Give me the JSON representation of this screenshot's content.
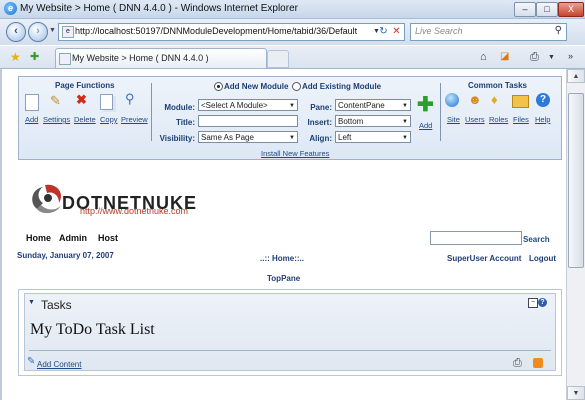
{
  "window": {
    "title": "My Website > Home ( DNN 4.4.0 ) - Windows Internet Explorer",
    "controls": [
      "–",
      "□",
      "X"
    ]
  },
  "browser": {
    "back_icon": "back-arrow-icon",
    "forward_icon": "forward-arrow-icon",
    "address": "http://localhost:50197/DNNModuleDevelopment/Home/tabid/36/Default",
    "refresh_glyph": "↻",
    "stop_glyph": "✕",
    "search_placeholder": "Live Search",
    "tab_title": "My Website > Home ( DNN 4.4.0 )",
    "toolbar_glyphs": {
      "home": "⌂",
      "feeds": "◪",
      "print": "⎙",
      "favorites": "★",
      "add_favorites": "✚"
    }
  },
  "control_panel": {
    "page_functions_header": "Page Functions",
    "page_functions": [
      "Add",
      "Settings",
      "Delete",
      "Copy",
      "Preview"
    ],
    "add_new_module": "Add New Module",
    "add_existing_module": "Add Existing Module",
    "module_label": "Module:",
    "module_value": "<Select A Module>",
    "pane_label": "Pane:",
    "pane_value": "ContentPane",
    "title_label": "Title:",
    "title_value": "",
    "insert_label": "Insert:",
    "insert_value": "Bottom",
    "visibility_label": "Visibility:",
    "visibility_value": "Same As Page",
    "align_label": "Align:",
    "align_value": "Left",
    "add_label": "Add",
    "install_features": "Install New Features",
    "common_tasks_header": "Common Tasks",
    "common_tasks": [
      "Site",
      "Users",
      "Roles",
      "Files",
      "Help"
    ]
  },
  "site": {
    "logo_text": "DOTNETNUKE",
    "logo_url": "http://www.dotnetnuke.com",
    "menu": [
      "Home",
      "Admin",
      "Host"
    ],
    "search_label": "Search",
    "date": "Sunday, January 07, 2007",
    "breadcrumb": "..:: Home::..",
    "user_account": "SuperUser Account",
    "logout": "Logout",
    "top_pane": "TopPane"
  },
  "module": {
    "title": "Tasks",
    "body": "My ToDo Task List",
    "add_content": "Add Content"
  },
  "colors": {
    "accent": "#1f4a86",
    "logo_red": "#c0332b",
    "panel_bg": "#e3ecf7"
  }
}
